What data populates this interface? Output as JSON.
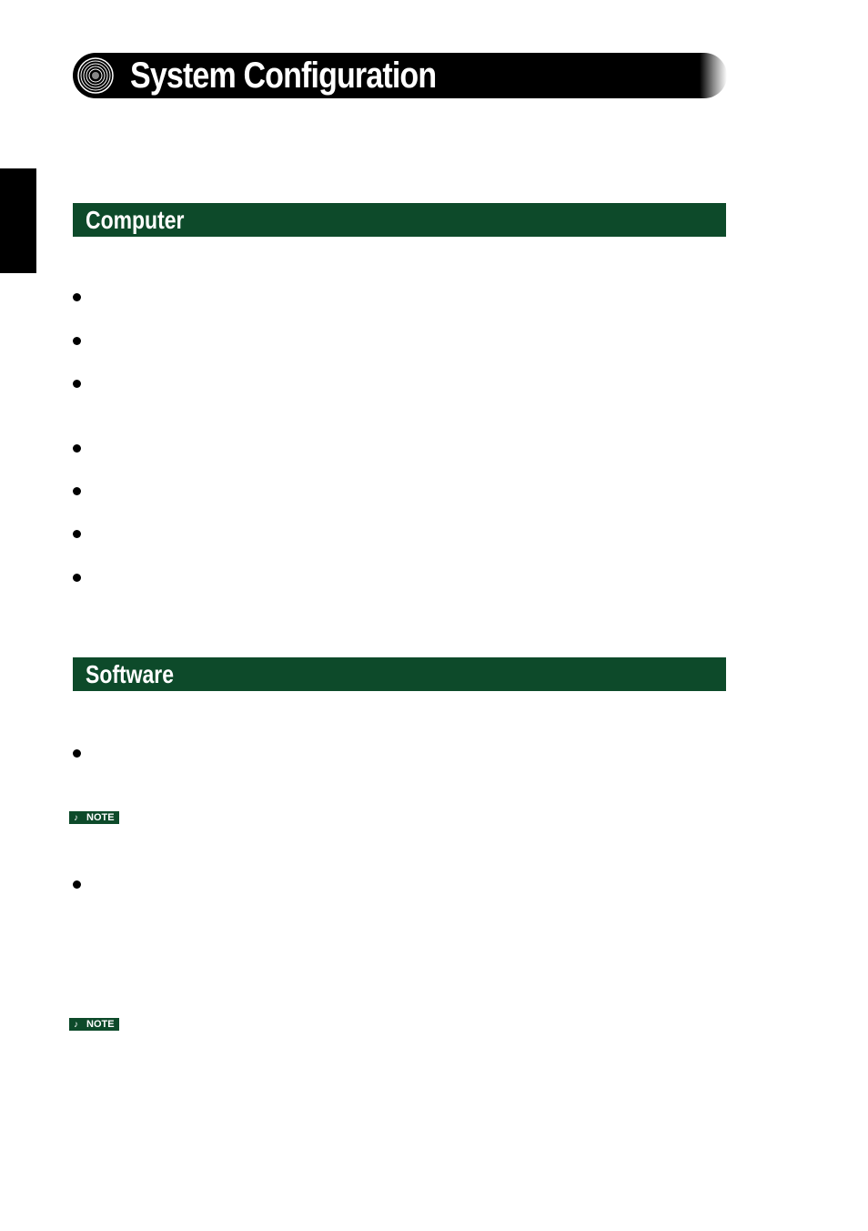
{
  "title": "System Configuration",
  "sections": {
    "computer": {
      "heading": "Computer"
    },
    "software": {
      "heading": "Software"
    }
  },
  "note_label": "NOTE",
  "note_icon": "♪"
}
